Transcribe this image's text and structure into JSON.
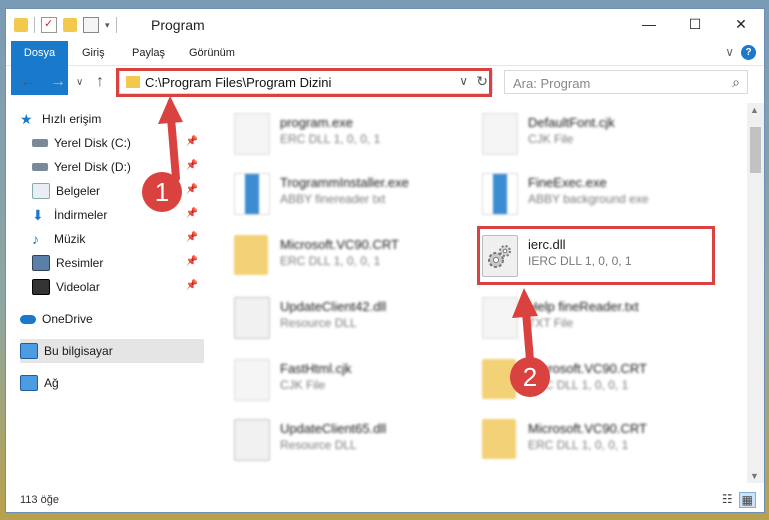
{
  "window": {
    "title": "Program"
  },
  "titlebar": {
    "minimize": "—",
    "maximize": "☐",
    "close": "✕"
  },
  "ribbon": {
    "tabs": [
      "Dosya",
      "Giriş",
      "Paylaş",
      "Görünüm"
    ],
    "collapse": "∨",
    "help": "?"
  },
  "nav": {
    "back": "←",
    "forward": "→",
    "recent": "∨",
    "up": "↑",
    "path": "C:\\Program Files\\Program Dizini",
    "dropdown": "∨",
    "refresh": "↻",
    "search_placeholder": "Ara: Program",
    "search_icon": "⌕"
  },
  "sidebar": {
    "items": [
      {
        "label": "Hızlı erişim",
        "icon": "star-icon",
        "pinned": false
      },
      {
        "label": "Yerel Disk (C:)",
        "icon": "drive-icon",
        "pinned": true
      },
      {
        "label": "Yerel Disk (D:)",
        "icon": "drive-icon",
        "pinned": true
      },
      {
        "label": "Belgeler",
        "icon": "documents-icon",
        "pinned": true
      },
      {
        "label": "İndirmeler",
        "icon": "download-icon",
        "pinned": true
      },
      {
        "label": "Müzik",
        "icon": "music-icon",
        "pinned": true
      },
      {
        "label": "Resimler",
        "icon": "pictures-icon",
        "pinned": true
      },
      {
        "label": "Videolar",
        "icon": "videos-icon",
        "pinned": true
      },
      {
        "label": "OneDrive",
        "icon": "cloud-icon",
        "pinned": false
      },
      {
        "label": "Bu bilgisayar",
        "icon": "computer-icon",
        "pinned": false
      },
      {
        "label": "Ağ",
        "icon": "network-icon",
        "pinned": false
      }
    ],
    "pin_glyph": "📌"
  },
  "files": [
    {
      "name": "program.exe",
      "sub": "ERC DLL 1, 0, 0, 1",
      "icon": "exe-icon"
    },
    {
      "name": "DefaultFont.cjk",
      "sub": "CJK File",
      "icon": "document-icon"
    },
    {
      "name": "TrogrammInstaller.exe",
      "sub": "ABBY finereader txt",
      "icon": "exe-icon"
    },
    {
      "name": "FineExec.exe",
      "sub": "ABBY background exe",
      "icon": "exe-icon"
    },
    {
      "name": "Microsoft.VC90.CRT",
      "sub": "ERC DLL 1, 0, 0, 1",
      "icon": "folder-icon"
    },
    {
      "name": "ierc.dll",
      "sub": "IERC DLL 1, 0, 0, 1",
      "icon": "dll-gear-icon"
    },
    {
      "name": "UpdateClient42.dll",
      "sub": "Resource DLL",
      "icon": "dll-gear-icon"
    },
    {
      "name": "Help fineReader.txt",
      "sub": "TXT File",
      "icon": "document-icon"
    },
    {
      "name": "FastHtml.cjk",
      "sub": "CJK File",
      "icon": "document-icon"
    },
    {
      "name": "Microsoft.VC90.CRT",
      "sub": "ERC DLL 1, 0, 0, 1",
      "icon": "folder-icon"
    },
    {
      "name": "UpdateClient65.dll",
      "sub": "Resource DLL",
      "icon": "dll-gear-icon"
    },
    {
      "name": "Microsoft.VC90.CRT",
      "sub": "ERC DLL 1, 0, 0, 1",
      "icon": "folder-icon"
    }
  ],
  "status": {
    "count": "113 öğe",
    "view_details": "☷",
    "view_tiles": "▦"
  },
  "annotations": {
    "badge1": "1",
    "badge2": "2",
    "color": "#d9423e"
  }
}
